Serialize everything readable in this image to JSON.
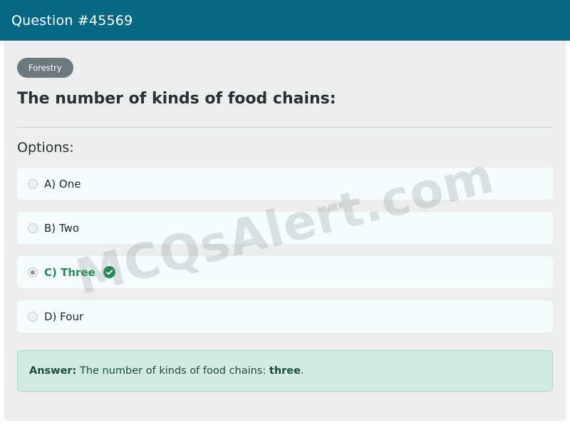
{
  "header": {
    "title": "Question #45569"
  },
  "category": {
    "label": "Forestry"
  },
  "question": {
    "text": "The number of kinds of food chains:"
  },
  "options_label": "Options:",
  "options": [
    {
      "label": "A) One",
      "selected": false,
      "correct": false
    },
    {
      "label": "B) Two",
      "selected": false,
      "correct": false
    },
    {
      "label": "C) Three",
      "selected": true,
      "correct": true
    },
    {
      "label": "D) Four",
      "selected": false,
      "correct": false
    }
  ],
  "answer": {
    "prefix": "Answer:",
    "text": "The number of kinds of food chains:",
    "value": "three",
    "suffix": "."
  },
  "watermark": "MCQsAlert.com",
  "colors": {
    "header_bg": "#066882",
    "correct": "#1f8a55",
    "answer_bg": "#d1ebe2",
    "badge_bg": "#6c7a80"
  },
  "icons": {
    "correct": "check-circle-icon"
  }
}
